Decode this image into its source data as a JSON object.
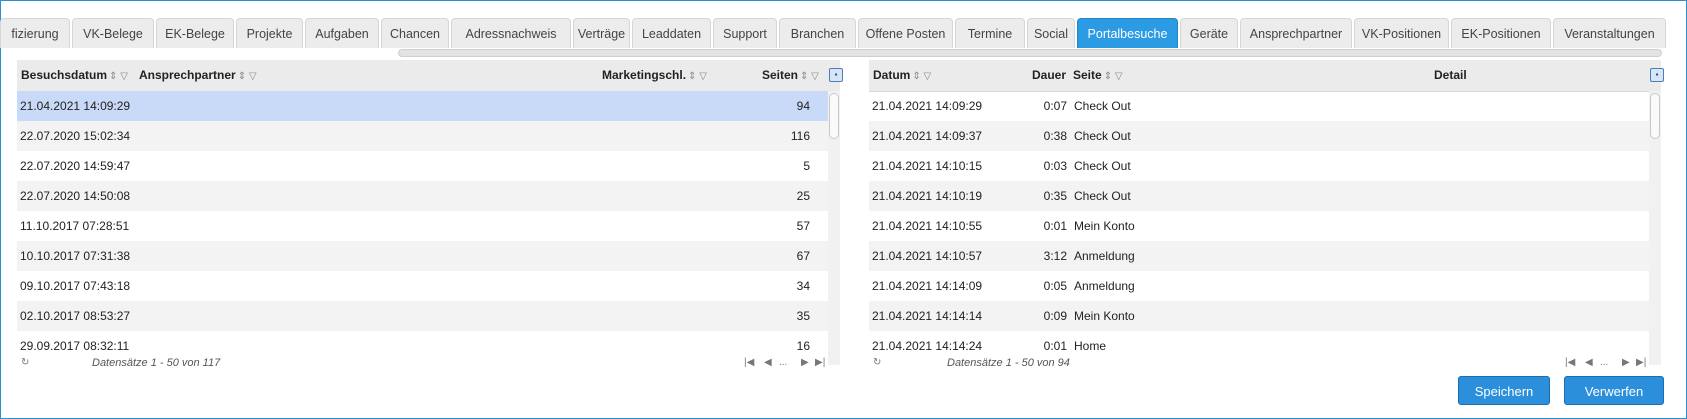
{
  "tabs": [
    "fizierung",
    "VK-Belege",
    "EK-Belege",
    "Projekte",
    "Aufgaben",
    "Chancen",
    "Adressnachweis",
    "Verträge",
    "Leaddaten",
    "Support",
    "Branchen",
    "Offene Posten",
    "Termine",
    "Social",
    "Portalbesuche",
    "Geräte",
    "Ansprechpartner",
    "VK-Positionen",
    "EK-Positionen",
    "Veranstaltungen"
  ],
  "active_tab": "Portalbesuche",
  "left_grid": {
    "headers": {
      "date": "Besuchsdatum",
      "contact": "Ansprechpartner",
      "marketing": "Marketingschl.",
      "pages": "Seiten"
    },
    "rows": [
      {
        "date": "21.04.2021 14:09:29",
        "pages": "94"
      },
      {
        "date": "22.07.2020 15:02:34",
        "pages": "116"
      },
      {
        "date": "22.07.2020 14:59:47",
        "pages": "5"
      },
      {
        "date": "22.07.2020 14:50:08",
        "pages": "25"
      },
      {
        "date": "11.10.2017 07:28:51",
        "pages": "57"
      },
      {
        "date": "10.10.2017 07:31:38",
        "pages": "67"
      },
      {
        "date": "09.10.2017 07:43:18",
        "pages": "34"
      },
      {
        "date": "02.10.2017 08:53:27",
        "pages": "35"
      },
      {
        "date": "29.09.2017 08:32:11",
        "pages": "16"
      }
    ],
    "pager_text": "Datensätze 1 - 50 von 117",
    "pager_dots": "..."
  },
  "right_grid": {
    "headers": {
      "date": "Datum",
      "duration": "Dauer",
      "page": "Seite",
      "detail": "Detail"
    },
    "rows": [
      {
        "date": "21.04.2021 14:09:29",
        "duration": "0:07",
        "page": "Check Out"
      },
      {
        "date": "21.04.2021 14:09:37",
        "duration": "0:38",
        "page": "Check Out"
      },
      {
        "date": "21.04.2021 14:10:15",
        "duration": "0:03",
        "page": "Check Out"
      },
      {
        "date": "21.04.2021 14:10:19",
        "duration": "0:35",
        "page": "Check Out"
      },
      {
        "date": "21.04.2021 14:10:55",
        "duration": "0:01",
        "page": "Mein Konto"
      },
      {
        "date": "21.04.2021 14:10:57",
        "duration": "3:12",
        "page": "Anmeldung"
      },
      {
        "date": "21.04.2021 14:14:09",
        "duration": "0:05",
        "page": "Anmeldung"
      },
      {
        "date": "21.04.2021 14:14:14",
        "duration": "0:09",
        "page": "Mein Konto"
      },
      {
        "date": "21.04.2021 14:14:24",
        "duration": "0:01",
        "page": "Home"
      }
    ],
    "pager_text": "Datensätze 1 - 50 von 94",
    "pager_dots": "..."
  },
  "buttons": {
    "save": "Speichern",
    "discard": "Verwerfen"
  },
  "colors": {
    "accent": "#2b9be3",
    "selected_row": "#c9daf8",
    "frame": "#2a8fd3"
  }
}
